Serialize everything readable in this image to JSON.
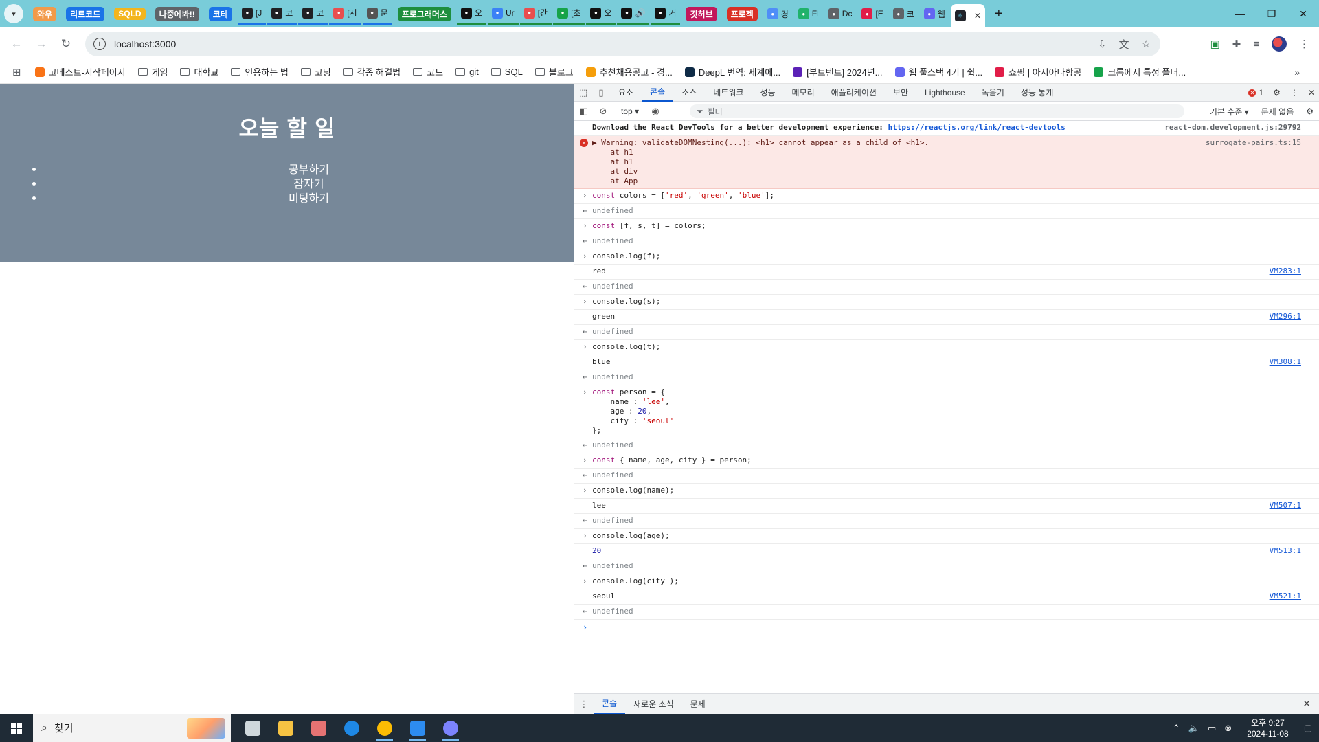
{
  "browser": {
    "tabs": [
      {
        "kind": "chip",
        "label": "와우",
        "color": "#f29a4a"
      },
      {
        "kind": "chip",
        "label": "리트코드",
        "color": "#1a73e8"
      },
      {
        "kind": "chip",
        "label": "SQLD",
        "color": "#f3b51c"
      },
      {
        "kind": "chip",
        "label": "나중에봐!!",
        "color": "#5f6368"
      },
      {
        "kind": "chip",
        "label": "코테",
        "color": "#1a73e8"
      },
      {
        "kind": "page",
        "label": "[J",
        "favcolor": "#202124",
        "line": "#1a73e8"
      },
      {
        "kind": "page",
        "label": "코",
        "favcolor": "#202124",
        "line": "#1a73e8"
      },
      {
        "kind": "page",
        "label": "코",
        "favcolor": "#202124",
        "line": "#1a73e8"
      },
      {
        "kind": "page",
        "label": "[시",
        "favcolor": "#e94e4e",
        "line": "#1a73e8"
      },
      {
        "kind": "page",
        "label": "문",
        "favcolor": "#555555",
        "line": "#1a73e8"
      },
      {
        "kind": "chip",
        "label": "프로그래머스",
        "color": "#1e8e3e"
      },
      {
        "kind": "page",
        "label": "오",
        "favcolor": "#111111",
        "line": "#1e8e3e"
      },
      {
        "kind": "page",
        "label": "Ur",
        "favcolor": "#3b82f6",
        "line": "#1e8e3e"
      },
      {
        "kind": "page",
        "label": "[간",
        "favcolor": "#e94e4e",
        "line": "#1e8e3e"
      },
      {
        "kind": "page",
        "label": "[초",
        "favcolor": "#16a34a",
        "line": "#1e8e3e"
      },
      {
        "kind": "page",
        "label": "오",
        "favcolor": "#111111",
        "line": "#1e8e3e"
      },
      {
        "kind": "page",
        "label": "🔊",
        "favcolor": "#111111",
        "line": "#1e8e3e"
      },
      {
        "kind": "page",
        "label": "커",
        "favcolor": "#111111",
        "line": "#1e8e3e"
      },
      {
        "kind": "chip",
        "label": "깃허브",
        "color": "#c2185b"
      },
      {
        "kind": "chip",
        "label": "프로젝",
        "color": "#d93025"
      },
      {
        "kind": "page",
        "label": "경",
        "favcolor": "#4f8ef7",
        "line": ""
      },
      {
        "kind": "page",
        "label": "Fl",
        "favcolor": "#20b26b",
        "line": ""
      },
      {
        "kind": "page",
        "label": "Dc",
        "favcolor": "#5f6368",
        "line": ""
      },
      {
        "kind": "page",
        "label": "[E",
        "favcolor": "#e11d48",
        "line": ""
      },
      {
        "kind": "page",
        "label": "코",
        "favcolor": "#5f6368",
        "line": ""
      },
      {
        "kind": "page",
        "label": "웹",
        "favcolor": "#6366f1",
        "line": ""
      }
    ],
    "active_tab": {
      "label": "",
      "close": "✕"
    },
    "new_tab": "+",
    "url": "localhost:3000",
    "bookmarks": [
      {
        "label": "고베스트-시작페이지",
        "type": "site",
        "icon_color": "#f97316"
      },
      {
        "label": "게임",
        "type": "folder"
      },
      {
        "label": "대학교",
        "type": "folder"
      },
      {
        "label": "인용하는 법",
        "type": "folder"
      },
      {
        "label": "코딩",
        "type": "folder"
      },
      {
        "label": "각종 해결법",
        "type": "folder"
      },
      {
        "label": "코드",
        "type": "folder"
      },
      {
        "label": "git",
        "type": "folder"
      },
      {
        "label": "SQL",
        "type": "folder"
      },
      {
        "label": "블로그",
        "type": "folder"
      },
      {
        "label": "추천채용공고 - 경...",
        "type": "site",
        "icon_color": "#f59e0b"
      },
      {
        "label": "DeepL 번역: 세계에...",
        "type": "site",
        "icon_color": "#0f2b46"
      },
      {
        "label": "[부트텐트] 2024년...",
        "type": "site",
        "icon_color": "#5b21b6"
      },
      {
        "label": "웹 풀스택 4기 | 쉽...",
        "type": "site",
        "icon_color": "#6366f1"
      },
      {
        "label": "쇼핑 | 아시아나항공",
        "type": "site",
        "icon_color": "#e11d48"
      },
      {
        "label": "크롬에서 특정 폴더...",
        "type": "site",
        "icon_color": "#16a34a"
      }
    ]
  },
  "page": {
    "title": "오늘 할 일",
    "todos": [
      "공부하기",
      "잠자기",
      "미팅하기"
    ]
  },
  "devtools": {
    "tabs": [
      "요소",
      "콘솔",
      "소스",
      "네트워크",
      "성능",
      "메모리",
      "애플리케이션",
      "보안",
      "Lighthouse",
      "녹음기",
      "성능 통계"
    ],
    "active_tab": "콘솔",
    "error_count": "1",
    "context": "top",
    "filter_placeholder": "필터",
    "level": "기본 수준",
    "issues": "문제 없음",
    "drawer_tabs": [
      "콘솔",
      "새로운 소식",
      "문제"
    ],
    "drawer_active": "콘솔",
    "console": [
      {
        "type": "info",
        "text": "Download the React DevTools for a better development experience: ",
        "link": "https://reactjs.org/link/react-devtools",
        "src": "react-dom.development.js:29792"
      },
      {
        "type": "error",
        "text": "▶ Warning: validateDOMNesting(...): <h1> cannot appear as a child of <h1>.\n    at h1\n    at h1\n    at div\n    at App",
        "src": "surrogate-pairs.ts:15"
      },
      {
        "type": "input",
        "html": "<span class='kw'>const</span> colors = [<span class='str'>'red'</span>, <span class='str'>'green'</span>, <span class='str'>'blue'</span>];"
      },
      {
        "type": "undef",
        "text": "undefined"
      },
      {
        "type": "input",
        "html": "<span class='kw'>const</span> [f, s, t] = colors;"
      },
      {
        "type": "undef",
        "text": "undefined"
      },
      {
        "type": "input",
        "html": "console.log(f);"
      },
      {
        "type": "result",
        "text": "red",
        "src": "VM283:1"
      },
      {
        "type": "undef",
        "text": "undefined"
      },
      {
        "type": "input",
        "html": "console.log(s);"
      },
      {
        "type": "result",
        "text": "green",
        "src": "VM296:1"
      },
      {
        "type": "undef",
        "text": "undefined"
      },
      {
        "type": "input",
        "html": "console.log(t);"
      },
      {
        "type": "result",
        "text": "blue",
        "src": "VM308:1"
      },
      {
        "type": "undef",
        "text": "undefined"
      },
      {
        "type": "input",
        "html": "<span class='kw'>const</span> person = {\n    name : <span class='str'>'lee'</span>,\n    age : <span class='numc'>20</span>,\n    city : <span class='str'>'seoul'</span>\n};"
      },
      {
        "type": "undef",
        "text": "undefined"
      },
      {
        "type": "input",
        "html": "<span class='kw'>const</span> { name, age, city } = person;"
      },
      {
        "type": "undef",
        "text": "undefined"
      },
      {
        "type": "input",
        "html": "console.log(name);"
      },
      {
        "type": "result",
        "text": "lee",
        "src": "VM507:1"
      },
      {
        "type": "undef",
        "text": "undefined"
      },
      {
        "type": "input",
        "html": "console.log(age);"
      },
      {
        "type": "result",
        "text": "20",
        "src": "VM513:1",
        "num": true
      },
      {
        "type": "undef",
        "text": "undefined"
      },
      {
        "type": "input",
        "html": "console.log(city );"
      },
      {
        "type": "result",
        "text": "seoul",
        "src": "VM521:1"
      },
      {
        "type": "undef",
        "text": "undefined"
      }
    ]
  },
  "taskbar": {
    "search_placeholder": "찾기",
    "time": "오후 9:27",
    "date": "2024-11-08",
    "apps": [
      {
        "name": "task-view",
        "color": "#cfd8dc",
        "running": false
      },
      {
        "name": "file-explorer",
        "color": "#f6c343",
        "running": false
      },
      {
        "name": "paint-app",
        "color": "#e57373",
        "running": false
      },
      {
        "name": "edge",
        "color": "#1e88e5",
        "running": false
      },
      {
        "name": "chrome",
        "color": "#fbbc04",
        "running": true
      },
      {
        "name": "vscode",
        "color": "#2d8cf0",
        "running": true
      },
      {
        "name": "discord",
        "color": "#7c83fd",
        "running": true
      }
    ]
  }
}
